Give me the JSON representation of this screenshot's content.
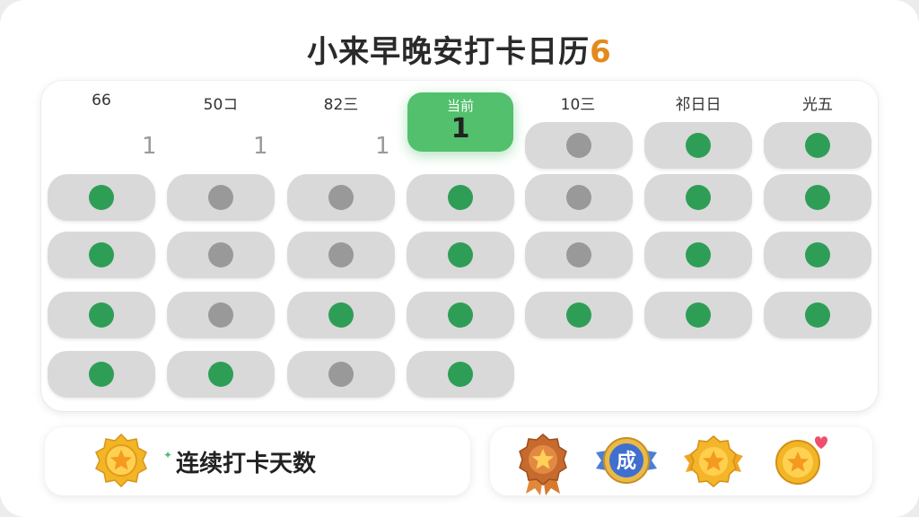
{
  "header": {
    "title": "小来早晚安打卡日历",
    "title_suffix": "6"
  },
  "calendar": {
    "columns": [
      {
        "label": "66"
      },
      {
        "label": "50コ"
      },
      {
        "label": "82三"
      },
      {
        "label": "当前",
        "today": true,
        "count": "1"
      },
      {
        "label": "10三"
      },
      {
        "label": "祁日日"
      },
      {
        "label": "光五"
      }
    ],
    "first_row_counts": [
      "1",
      "1",
      "1"
    ],
    "rows": [
      [
        null,
        null,
        null,
        null,
        "missed",
        "done",
        "done"
      ],
      [
        "done",
        "missed",
        "missed",
        "done",
        "missed",
        "done",
        "done"
      ],
      [
        "done",
        "missed",
        "missed",
        "done",
        "missed",
        "done",
        "done"
      ],
      [
        "done",
        "missed",
        "done",
        "done",
        "done",
        "done",
        "done"
      ],
      [
        "done",
        "done",
        "missed",
        "done",
        null,
        null,
        null
      ]
    ],
    "colors": {
      "done": "#2e9e57",
      "missed": "#999999",
      "today_accent": "#52c06c"
    }
  },
  "streak": {
    "label": "连续打卡天数",
    "icon": "gold-star-medal-icon"
  },
  "badges": [
    {
      "icon": "bronze-star-ribbon-medal-icon"
    },
    {
      "icon": "blue-achievement-badge-icon",
      "text": "成"
    },
    {
      "icon": "gold-star-badge-icon"
    },
    {
      "icon": "gold-star-heart-badge-icon"
    }
  ]
}
